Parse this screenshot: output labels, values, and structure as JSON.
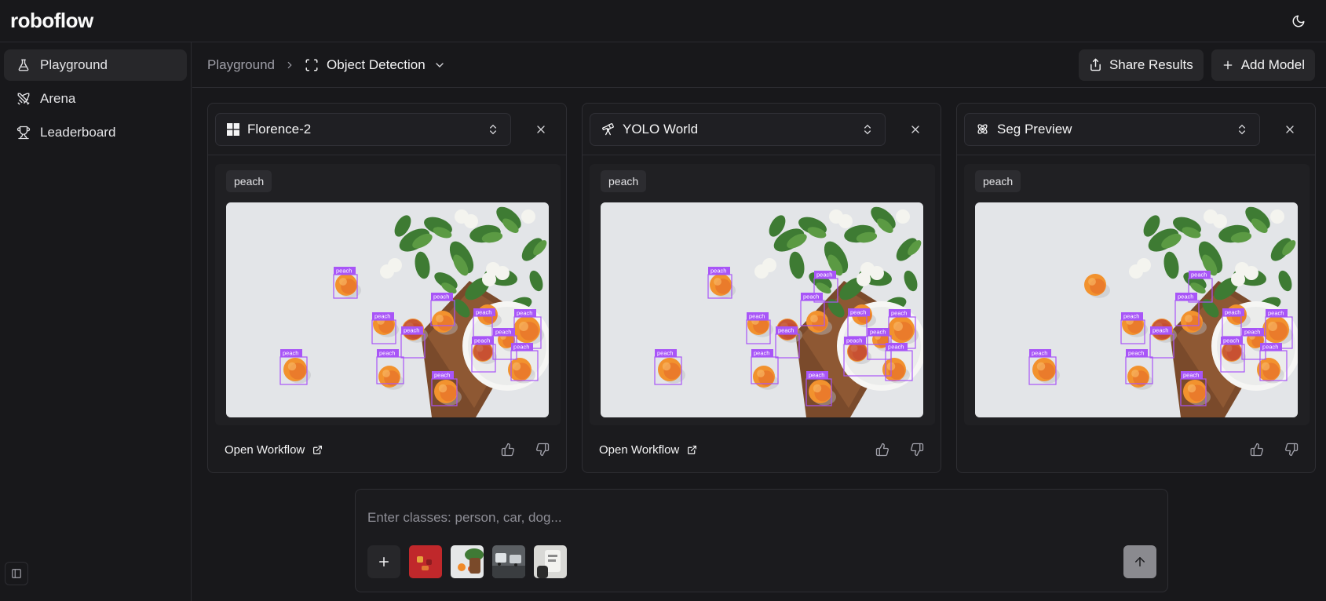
{
  "app": {
    "logo": "roboflow"
  },
  "topbar": {
    "theme_icon": "moon-icon"
  },
  "sidebar": {
    "items": [
      {
        "label": "Playground",
        "icon": "flask-icon",
        "active": true
      },
      {
        "label": "Arena",
        "icon": "swords-icon",
        "active": false
      },
      {
        "label": "Leaderboard",
        "icon": "trophy-icon",
        "active": false
      }
    ]
  },
  "header": {
    "breadcrumb_root": "Playground",
    "current": "Object Detection",
    "share_label": "Share Results",
    "add_label": "Add Model"
  },
  "panels": [
    {
      "model": "Florence-2",
      "icon": "windows-icon",
      "tag": "peach",
      "open_workflow": "Open Workflow",
      "has_workflow": true
    },
    {
      "model": "YOLO World",
      "icon": "telescope-icon",
      "tag": "peach",
      "open_workflow": "Open Workflow",
      "has_workflow": true
    },
    {
      "model": "Seg Preview",
      "icon": "atom-icon",
      "tag": "peach",
      "open_workflow": "",
      "has_workflow": false
    }
  ],
  "detections": {
    "label": "peach",
    "accent_color": "#a855f7"
  },
  "prompt": {
    "placeholder": "Enter classes: person, car, dog..."
  },
  "colors": {
    "background": "#18181b",
    "surface": "#27272a",
    "border": "#2e2e33",
    "text": "#f4f4f5",
    "muted": "#9f9fa8"
  }
}
